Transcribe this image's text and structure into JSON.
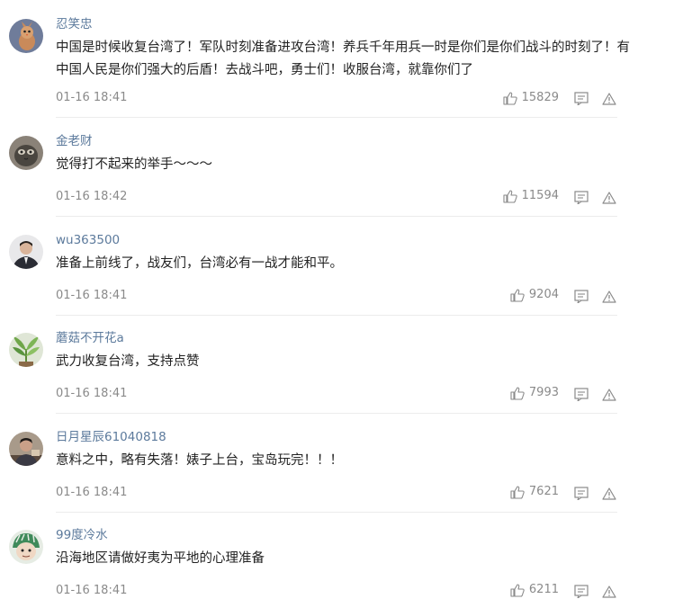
{
  "comments": [
    {
      "username": "忍笑忠",
      "content": "中国是时候收复台湾了！军队时刻准备进攻台湾！养兵千年用兵一时是你们是你们战斗的时刻了！有中国人民是你们强大的后盾！去战斗吧，勇士们！收服台湾，就靠你们了",
      "time": "01-16 18:41",
      "likes": "15829",
      "avatar": "bird-avatar-icon"
    },
    {
      "username": "金老财",
      "content": "觉得打不起来的举手～～～",
      "time": "01-16 18:42",
      "likes": "11594",
      "avatar": "cat-avatar-icon"
    },
    {
      "username": "wu363500",
      "content": "准备上前线了，战友们，台湾必有一战才能和平。",
      "time": "01-16 18:41",
      "likes": "9204",
      "avatar": "suit-man-avatar-icon"
    },
    {
      "username": "蘑菇不开花a",
      "content": "武力收复台湾，支持点赞",
      "time": "01-16 18:41",
      "likes": "7993",
      "avatar": "plant-avatar-icon"
    },
    {
      "username": "日月星辰61040818",
      "content": "意料之中，略有失落！婊子上台，宝岛玩完！！！",
      "time": "01-16 18:41",
      "likes": "7621",
      "avatar": "man-photo-avatar-icon"
    },
    {
      "username": "99度冷水",
      "content": "沿海地区请做好夷为平地的心理准备",
      "time": "01-16 18:41",
      "likes": "6211",
      "avatar": "cartoon-avatar-icon"
    }
  ],
  "colors": {
    "username": "#5c7a9c",
    "text": "#222222",
    "meta": "#8a8a8a",
    "divider": "#ececec"
  }
}
